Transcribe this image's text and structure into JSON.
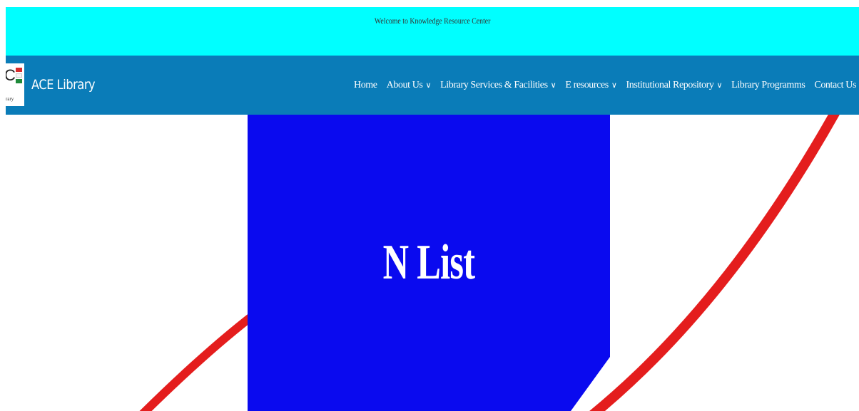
{
  "topbar": {
    "welcome_text": "Welcome to Knowledge Resource Center"
  },
  "header": {
    "brand": "ACE Library",
    "logo": {
      "letter": "C",
      "caption": "rary",
      "squares": [
        "#d62d2d",
        "#ffffff",
        "#1f8a3a"
      ]
    }
  },
  "nav": {
    "home": "Home",
    "about": "About Us",
    "services": "Library Services & Facilities",
    "eresources": "E resources",
    "repository": "Institutional Repository",
    "programs": "Library Programms",
    "contact": "Contact Us",
    "caret_icon": "chevron-down-icon"
  },
  "hero": {
    "title": "N List",
    "panel_color": "#0a0aef",
    "arc_color": "#e41d1d"
  },
  "colors": {
    "topbar": "#00ffff",
    "nav": "#0a7cb8"
  }
}
